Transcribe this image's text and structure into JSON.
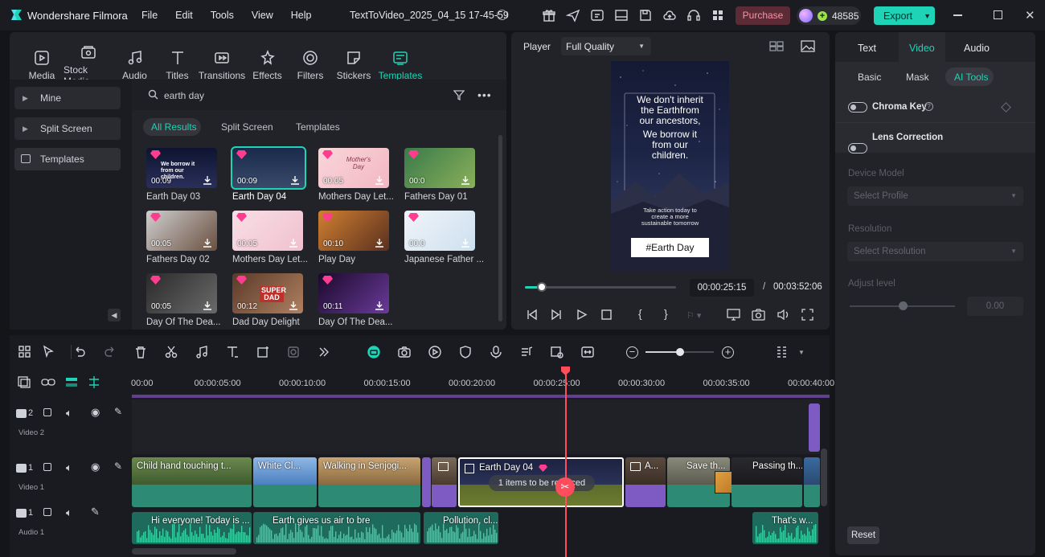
{
  "app": {
    "name": "Wondershare Filmora",
    "project_title": "TextToVideo_2025_04_15 17-45-59"
  },
  "menu": [
    "File",
    "Edit",
    "Tools",
    "View",
    "Help"
  ],
  "titlebar": {
    "purchase_label": "Purchase",
    "credits": "48585",
    "export_label": "Export"
  },
  "library": {
    "tabs": [
      {
        "label": "Media",
        "icon": "media-icon"
      },
      {
        "label": "Stock Media",
        "icon": "stock-media-icon"
      },
      {
        "label": "Audio",
        "icon": "audio-icon"
      },
      {
        "label": "Titles",
        "icon": "titles-icon"
      },
      {
        "label": "Transitions",
        "icon": "transitions-icon"
      },
      {
        "label": "Effects",
        "icon": "effects-icon"
      },
      {
        "label": "Filters",
        "icon": "filters-icon"
      },
      {
        "label": "Stickers",
        "icon": "stickers-icon"
      },
      {
        "label": "Templates",
        "icon": "templates-icon"
      }
    ],
    "active_tab": "Templates",
    "sidebar": [
      "Mine",
      "Split Screen",
      "Templates"
    ],
    "search_value": "earth day",
    "filters": [
      "All Results",
      "Split Screen",
      "Templates"
    ],
    "templates": [
      {
        "title": "Earth Day 03",
        "duration": "00:09"
      },
      {
        "title": "Earth Day 04",
        "duration": "00:09"
      },
      {
        "title": "Mothers Day Let...",
        "duration": "00:05"
      },
      {
        "title": "Fathers Day 01",
        "duration": "00:0"
      },
      {
        "title": "Fathers Day 02",
        "duration": "00:05"
      },
      {
        "title": "Mothers Day Let...",
        "duration": "00:05"
      },
      {
        "title": "Play Day",
        "duration": "00:10"
      },
      {
        "title": "Japanese Father ...",
        "duration": "00:0"
      },
      {
        "title": "Day Of The Dea...",
        "duration": "00:05"
      },
      {
        "title": "Dad Day Delight",
        "duration": "00:12"
      },
      {
        "title": "Day Of The Dea...",
        "duration": "00:11"
      }
    ],
    "thumb_texts": {
      "earth03": "We borrow it from our children.",
      "mothers": "Mother's Day",
      "super_dad": "SUPER DAD"
    }
  },
  "player": {
    "label": "Player",
    "quality": "Full Quality",
    "preview_lines": [
      "We don't inherit",
      "the Earthfrom",
      "our ancestors,",
      "We borrow it",
      "from our",
      "children."
    ],
    "preview_sub": [
      "Take action today to",
      "create a more",
      "sustainable tomorrow"
    ],
    "preview_tag": "#Earth Day",
    "current_time": "00:00:25:15",
    "separator": "/",
    "total_time": "00:03:52:06",
    "progress": 0.11
  },
  "timeline": {
    "ruler": [
      "00:00",
      "00:00:05:00",
      "00:00:10:00",
      "00:00:15:00",
      "00:00:20:00",
      "00:00:25:00",
      "00:00:30:00",
      "00:00:35:00",
      "00:00:40:00"
    ],
    "tracks": [
      {
        "num": "2",
        "label": "Video 2"
      },
      {
        "num": "1",
        "label": "Video 1"
      },
      {
        "num": "1",
        "label": "Audio 1"
      }
    ],
    "video_clips": [
      "Child hand touching t...",
      "White Cl...",
      "Walking in Senjogi...",
      "Earth Day 04",
      "A...",
      "Save th...",
      "Passing th..."
    ],
    "selected_overlay": "1 items to be replaced",
    "audio_clips": [
      "Hi everyone! Today is ...",
      "Earth gives us air to bre",
      "Pollution, cl...",
      "That's w..."
    ],
    "zoom": 0.5
  },
  "inspector": {
    "tabs": [
      "Text",
      "Video",
      "Audio"
    ],
    "active_tab": "Video",
    "subtabs": [
      "Basic",
      "Mask",
      "AI Tools"
    ],
    "active_subtab": "AI Tools",
    "chroma_key": "Chroma Key",
    "lens_correction": "Lens Correction",
    "device_model_label": "Device Model",
    "device_model_placeholder": "Select Profile",
    "resolution_label": "Resolution",
    "resolution_placeholder": "Select Resolution",
    "adjust_level_label": "Adjust level",
    "adjust_level_value": "0.00",
    "adjust_level": 0.5,
    "reset_label": "Reset"
  },
  "colors": {
    "accent": "#1fd3b6",
    "purchase": "#ff6b8a",
    "playhead": "#ff4d5e"
  }
}
